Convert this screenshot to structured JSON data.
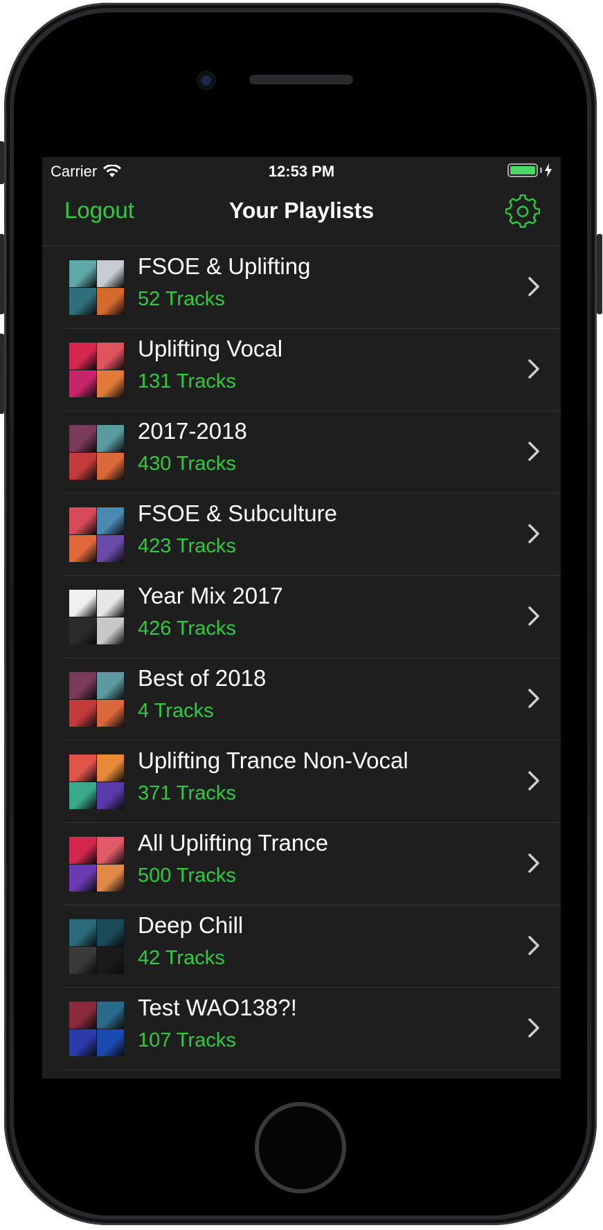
{
  "status_bar": {
    "carrier": "Carrier",
    "time": "12:53 PM"
  },
  "nav": {
    "left_button": "Logout",
    "title": "Your Playlists",
    "right_icon": "gear-icon"
  },
  "colors": {
    "accent": "#2ecc40",
    "background": "#1e1e1e",
    "separator": "#333333",
    "text": "#ffffff"
  },
  "playlists": [
    {
      "title": "FSOE & Uplifting",
      "subtitle": "52 Tracks",
      "art": [
        "#5fa8a8",
        "#c7ccd3",
        "#2e6f7b",
        "#d46a2e"
      ]
    },
    {
      "title": "Uplifting Vocal",
      "subtitle": "131 Tracks",
      "art": [
        "#d6284e",
        "#e0545f",
        "#c8246a",
        "#e07a3a"
      ]
    },
    {
      "title": "2017-2018",
      "subtitle": "430 Tracks",
      "art": [
        "#7a3a5a",
        "#5a9aa0",
        "#c23a3a",
        "#d9683a"
      ]
    },
    {
      "title": "FSOE & Subculture",
      "subtitle": "423 Tracks",
      "art": [
        "#d64a5a",
        "#4a8ab0",
        "#e0683a",
        "#6a4aa8"
      ]
    },
    {
      "title": "Year Mix 2017",
      "subtitle": "426 Tracks",
      "art": [
        "#f0f0f0",
        "#e6e6e6",
        "#2a2a2a",
        "#c8c8c8"
      ]
    },
    {
      "title": "Best of 2018",
      "subtitle": "4 Tracks",
      "art": [
        "#7a3a5a",
        "#5a9aa0",
        "#c23a3a",
        "#d9683a"
      ]
    },
    {
      "title": "Uplifting Trance Non-Vocal",
      "subtitle": "371 Tracks",
      "art": [
        "#e0544a",
        "#e68a3a",
        "#3aa88a",
        "#5a3aa8"
      ]
    },
    {
      "title": "All Uplifting Trance",
      "subtitle": "500 Tracks",
      "art": [
        "#d6284e",
        "#e05a6a",
        "#6a3ab0",
        "#e08a4a"
      ]
    },
    {
      "title": "Deep Chill",
      "subtitle": "42 Tracks",
      "art": [
        "#2a6a7a",
        "#1a4a5a",
        "#3a3a3a",
        "#1a1a1a"
      ]
    },
    {
      "title": "Test WAO138?!",
      "subtitle": "107 Tracks",
      "art": [
        "#8a2a3a",
        "#2a6a8a",
        "#2a3aa8",
        "#1a4ab0"
      ]
    }
  ]
}
